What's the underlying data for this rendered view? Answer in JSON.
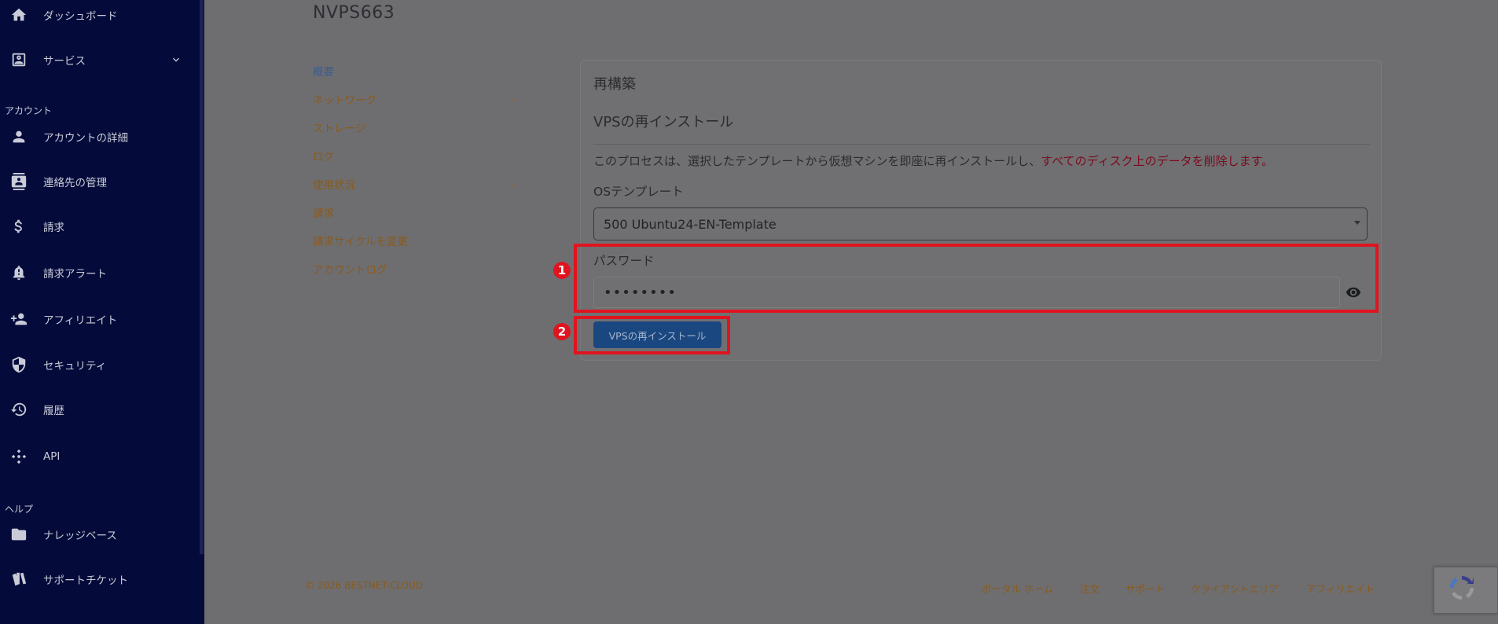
{
  "sidebar": {
    "items": [
      {
        "label": "ダッシュボード",
        "icon": "home-icon"
      },
      {
        "label": "サービス",
        "icon": "service-icon"
      },
      {
        "label": "アカウントの詳細",
        "icon": "person-icon"
      },
      {
        "label": "連絡先の管理",
        "icon": "contacts-icon"
      },
      {
        "label": "請求",
        "icon": "dollar-icon"
      },
      {
        "label": "請求アラート",
        "icon": "bell-icon"
      },
      {
        "label": "アフィリエイト",
        "icon": "add-person-icon"
      },
      {
        "label": "セキュリティ",
        "icon": "shield-icon"
      },
      {
        "label": "履歴",
        "icon": "history-icon"
      },
      {
        "label": "API",
        "icon": "api-icon"
      },
      {
        "label": "ナレッジベース",
        "icon": "folder-icon"
      },
      {
        "label": "サポートチケット",
        "icon": "tickets-icon"
      }
    ],
    "sections": {
      "account": "アカウント",
      "help": "ヘルプ"
    }
  },
  "page": {
    "title": "NVPS663"
  },
  "subnav": {
    "items": [
      {
        "label": "概要"
      },
      {
        "label": "ネットワーク"
      },
      {
        "label": "ストレージ"
      },
      {
        "label": "ログ"
      },
      {
        "label": "使用状況"
      },
      {
        "label": "請求"
      },
      {
        "label": "請求サイクルを変更"
      },
      {
        "label": "アカウントログ"
      }
    ]
  },
  "card": {
    "title": "再構築",
    "subtitle": "VPSの再インストール",
    "description": "このプロセスは、選択したテンプレートから仮想マシンを即座に再インストールし、",
    "warning": "すべてのディスク上のデータを削除します。",
    "os_label": "OSテンプレート",
    "os_value": "500 Ubuntu24-EN-Template",
    "password_label": "パスワード",
    "password_value": "••••••••",
    "submit_label": "VPSの再インストール"
  },
  "annotations": {
    "one": "1",
    "two": "2",
    "color": "#e0141f"
  },
  "footer": {
    "copyright": "© 2026 BESTNET-CLOUD",
    "links": [
      "ポータル ホーム",
      "注文",
      "サポート",
      "クライアントエリア",
      "アフィリエイト"
    ]
  }
}
